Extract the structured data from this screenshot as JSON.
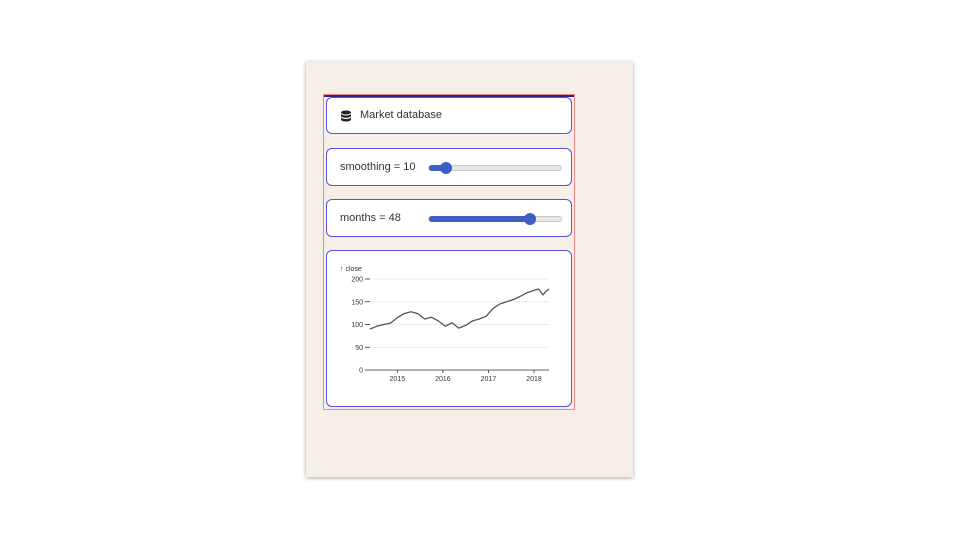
{
  "header": {
    "icon": "database-icon",
    "title": "Market database"
  },
  "controls": {
    "smoothing": {
      "label": "smoothing = 10",
      "name": "smoothing",
      "value": 10,
      "min": 0,
      "max": 100,
      "fraction": 0.13
    },
    "months": {
      "label": "months = 48",
      "name": "months",
      "value": 48,
      "fraction": 0.75
    }
  },
  "colors": {
    "accent": "#3d5fc4",
    "card_border": "#5a50e0",
    "page_background": "#f6efe7",
    "line": "#555555"
  },
  "chart_data": {
    "type": "line",
    "ylabel": "↑ close",
    "ylim": [
      0,
      200
    ],
    "yticks": [
      0,
      50,
      100,
      150,
      200
    ],
    "xticks": [
      "2015",
      "2016",
      "2017",
      "2018"
    ],
    "xlim": [
      2014.4,
      2018.33
    ],
    "grid": true,
    "series": [
      {
        "x": [
          2014.4,
          2014.55,
          2014.7,
          2014.85,
          2015.0,
          2015.15,
          2015.3,
          2015.45,
          2015.6,
          2015.75,
          2015.9,
          2016.05,
          2016.2,
          2016.35,
          2016.5,
          2016.65,
          2016.8,
          2016.95,
          2017.1,
          2017.25,
          2017.4,
          2017.55,
          2017.7,
          2017.85,
          2018.0,
          2018.1,
          2018.2,
          2018.25,
          2018.33
        ],
        "y": [
          90,
          96,
          100,
          103,
          115,
          124,
          128,
          124,
          112,
          116,
          108,
          96,
          104,
          92,
          98,
          108,
          112,
          118,
          135,
          145,
          150,
          155,
          162,
          170,
          175,
          178,
          165,
          172,
          178
        ]
      }
    ]
  }
}
